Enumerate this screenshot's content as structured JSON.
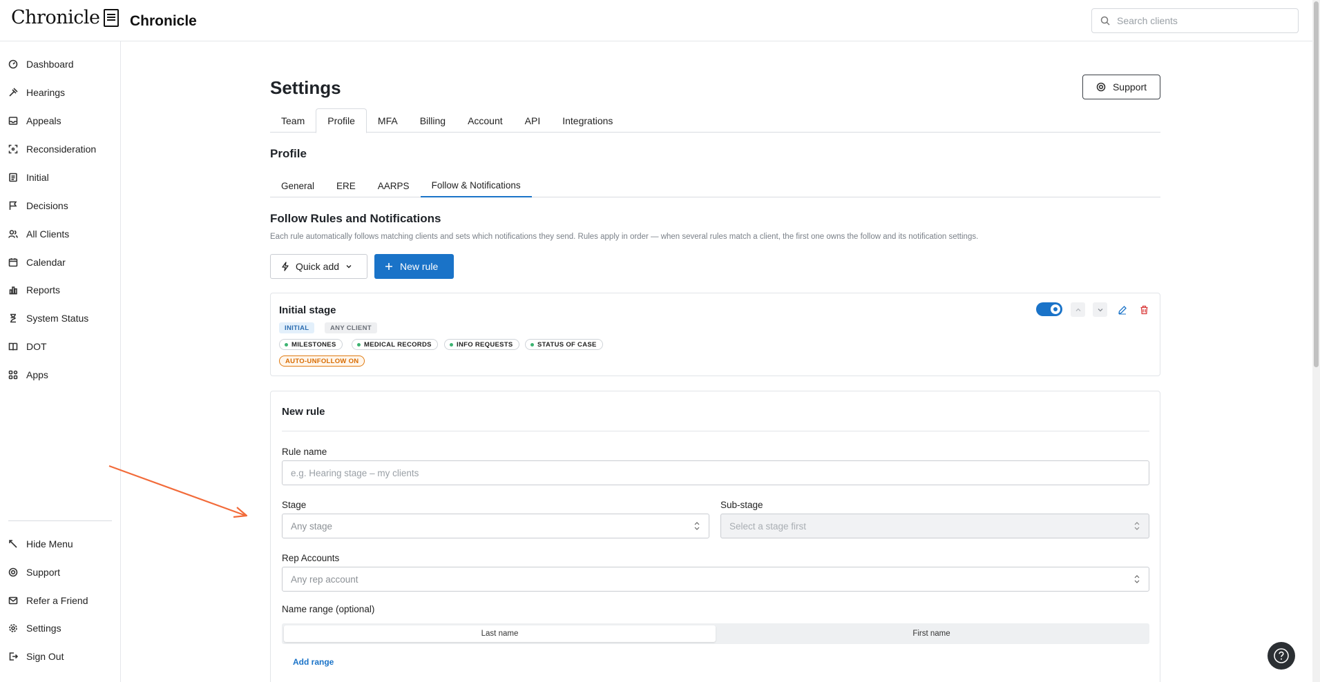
{
  "header": {
    "logo_text": "Chronicle",
    "app_title": "Chronicle",
    "search_placeholder": "Search clients"
  },
  "sidebar": {
    "items": [
      {
        "label": "Dashboard",
        "icon": "dashboard-icon"
      },
      {
        "label": "Hearings",
        "icon": "gavel-icon"
      },
      {
        "label": "Appeals",
        "icon": "inbox-icon"
      },
      {
        "label": "Reconsideration",
        "icon": "scan-icon"
      },
      {
        "label": "Initial",
        "icon": "document-icon"
      },
      {
        "label": "Decisions",
        "icon": "flag-icon"
      },
      {
        "label": "All Clients",
        "icon": "users-icon"
      },
      {
        "label": "Calendar",
        "icon": "calendar-icon"
      },
      {
        "label": "Reports",
        "icon": "chart-icon"
      },
      {
        "label": "System Status",
        "icon": "hourglass-icon"
      },
      {
        "label": "DOT",
        "icon": "book-icon"
      },
      {
        "label": "Apps",
        "icon": "apps-icon"
      }
    ],
    "bottom_items": [
      {
        "label": "Hide Menu",
        "icon": "collapse-icon"
      },
      {
        "label": "Support",
        "icon": "lifebuoy-icon"
      },
      {
        "label": "Refer a Friend",
        "icon": "mail-icon"
      },
      {
        "label": "Settings",
        "icon": "gear-icon"
      },
      {
        "label": "Sign Out",
        "icon": "sign-out-icon"
      }
    ]
  },
  "page": {
    "title": "Settings",
    "support_label": "Support",
    "tabs": [
      "Team",
      "Profile",
      "MFA",
      "Billing",
      "Account",
      "API",
      "Integrations"
    ],
    "active_tab": "Profile",
    "section_title": "Profile",
    "subtabs": [
      "General",
      "ERE",
      "AARPS",
      "Follow & Notifications"
    ],
    "active_subtab": "Follow & Notifications"
  },
  "rules": {
    "title": "Follow Rules and Notifications",
    "description": "Each rule automatically follows matching clients and sets which notifications they send. Rules apply in order — when several rules match a client, the first one owns the follow and its notification settings.",
    "quick_add_label": "Quick add",
    "new_rule_label": "New rule",
    "items": [
      {
        "name": "Initial stage",
        "stage_chip": "INITIAL",
        "client_chip": "ANY CLIENT",
        "notifications": [
          "MILESTONES",
          "MEDICAL RECORDS",
          "INFO REQUESTS",
          "STATUS OF CASE"
        ],
        "auto_unfollow": "AUTO-UNFOLLOW ON",
        "enabled": true
      }
    ]
  },
  "new_rule_form": {
    "title": "New rule",
    "rule_name_label": "Rule name",
    "rule_name_placeholder": "e.g. Hearing stage – my clients",
    "stage_label": "Stage",
    "stage_placeholder": "Any stage",
    "substage_label": "Sub-stage",
    "substage_placeholder": "Select a stage first",
    "rep_accounts_label": "Rep Accounts",
    "rep_accounts_placeholder": "Any rep account",
    "name_range_label": "Name range (optional)",
    "name_range_options": [
      "Last name",
      "First name"
    ],
    "name_range_selected": "Last name",
    "add_range_label": "Add range"
  },
  "colors": {
    "accent": "#1a73c8",
    "annotation_arrow": "#f26b3a",
    "auto_unfollow": "#d86b00",
    "notification_dot": "#3cb371"
  }
}
